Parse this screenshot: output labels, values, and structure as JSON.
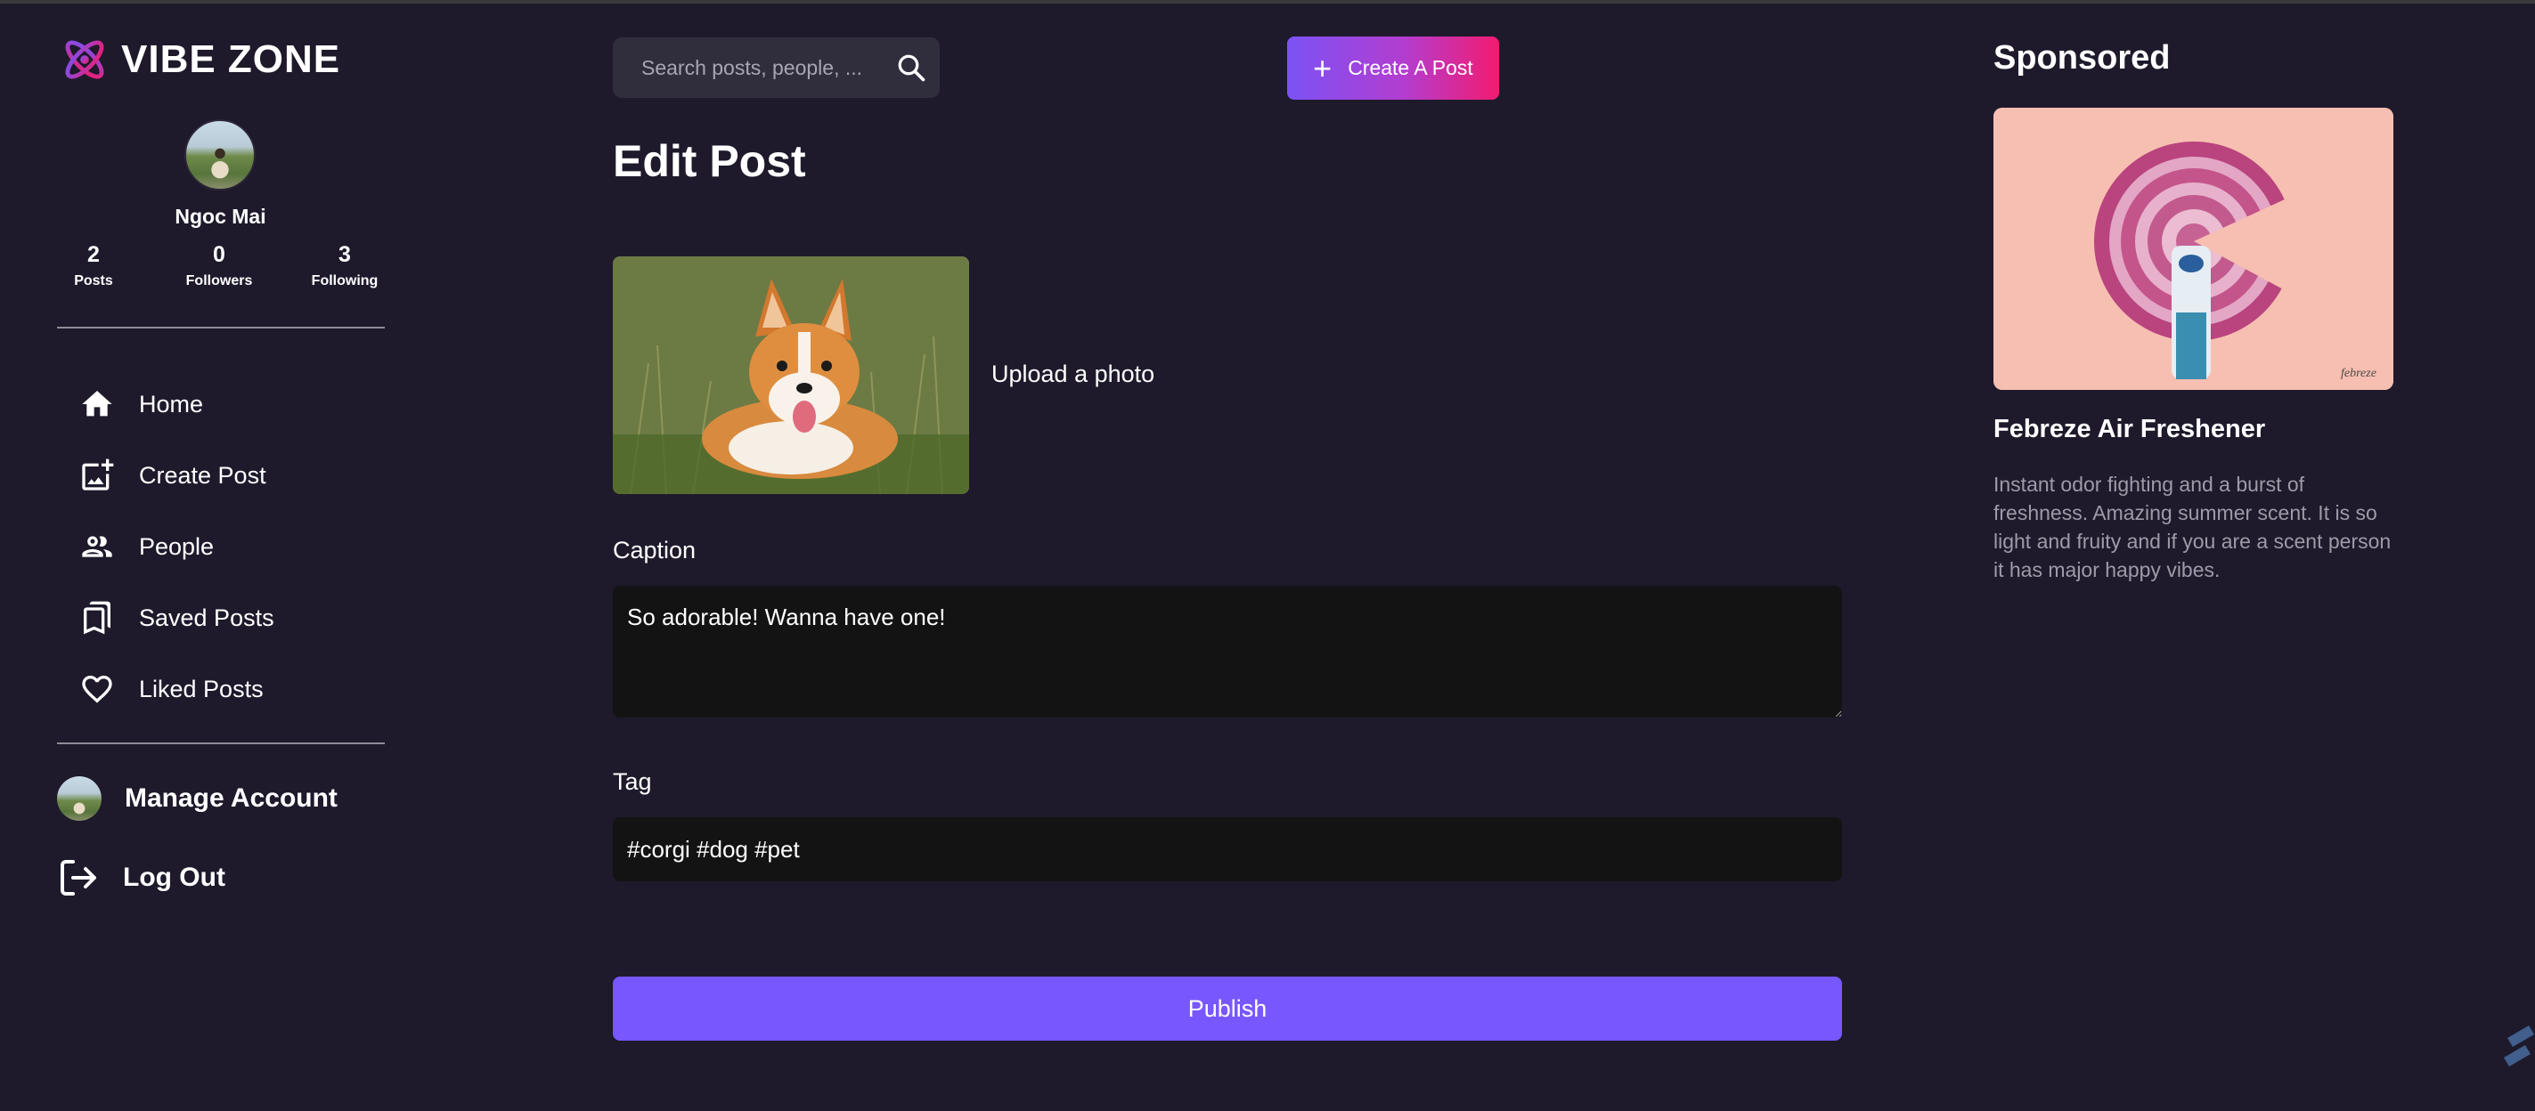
{
  "brand": {
    "name": "VIBE ZONE"
  },
  "user": {
    "name": "Ngoc Mai",
    "stats": [
      {
        "value": "2",
        "label": "Posts"
      },
      {
        "value": "0",
        "label": "Followers"
      },
      {
        "value": "3",
        "label": "Following"
      }
    ]
  },
  "nav": {
    "items": [
      {
        "label": "Home",
        "icon": "home-icon"
      },
      {
        "label": "Create Post",
        "icon": "add-photo-icon"
      },
      {
        "label": "People",
        "icon": "people-icon"
      },
      {
        "label": "Saved Posts",
        "icon": "bookmarks-icon"
      },
      {
        "label": "Liked Posts",
        "icon": "heart-icon"
      }
    ]
  },
  "account": {
    "manage_label": "Manage Account",
    "logout_label": "Log Out"
  },
  "search": {
    "placeholder": "Search posts, people, ..."
  },
  "create_button": {
    "label": "Create A Post"
  },
  "editor": {
    "title": "Edit Post",
    "upload_label": "Upload a photo",
    "caption_label": "Caption",
    "caption_value": "So adorable! Wanna have one!",
    "tag_label": "Tag",
    "tag_value": "#corgi #dog #pet",
    "publish_label": "Publish"
  },
  "sponsored": {
    "heading": "Sponsored",
    "ad_title": "Febreze Air Freshener",
    "ad_description": "Instant odor fighting and a burst of freshness. Amazing summer scent. It is so light and fruity and if you are a scent person it has major happy vibes."
  },
  "colors": {
    "background": "#1e1a2b",
    "accent": "#7857ff",
    "gradient_start": "#7b52f5",
    "gradient_end": "#f21b6f",
    "input_bg": "#131313"
  }
}
